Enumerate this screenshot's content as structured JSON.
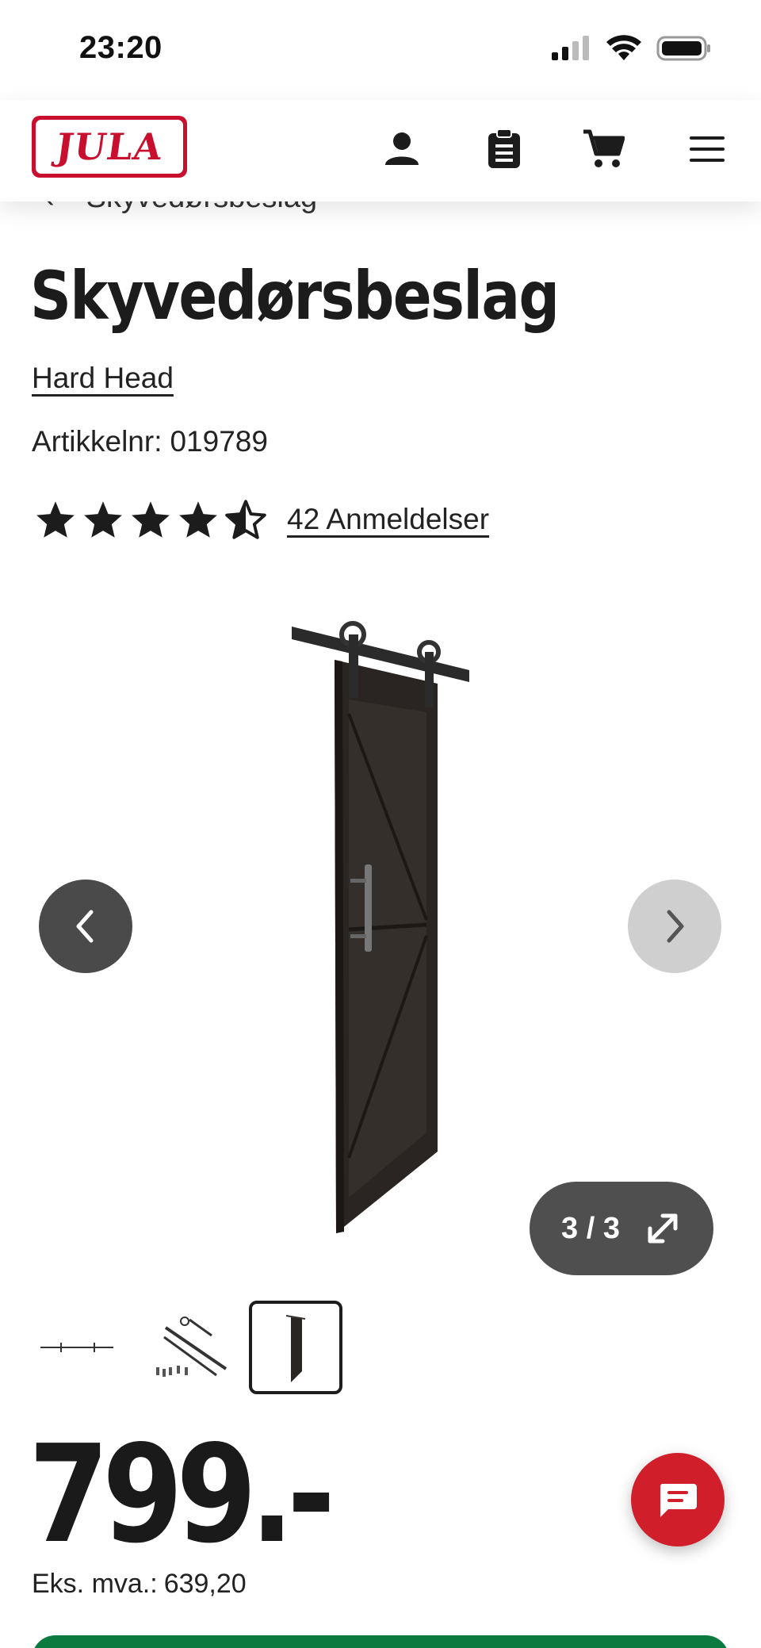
{
  "status_bar": {
    "time": "23:20"
  },
  "header": {
    "logo_text": "JULA",
    "brand_color": "#c8102e"
  },
  "breadcrumb": {
    "label": "Skyvedørsbeslag"
  },
  "product": {
    "title": "Skyvedørsbeslag",
    "brand": "Hard Head",
    "article_label": "Artikkelnr:",
    "article_number": "019789",
    "rating": 4.5,
    "rating_max": 5,
    "reviews_text": "42 Anmeldelser",
    "price": "799.-",
    "ex_vat_label": "Eks. mva.:",
    "ex_vat_value": "639,20"
  },
  "gallery": {
    "counter": "3 / 3",
    "thumbnails": [
      "rail-thumbnail",
      "hardware-kit-thumbnail",
      "door-thumbnail"
    ],
    "active_index": 2
  },
  "colors": {
    "accent_green": "#0b7a3e",
    "chat_red": "#d01e2a"
  }
}
